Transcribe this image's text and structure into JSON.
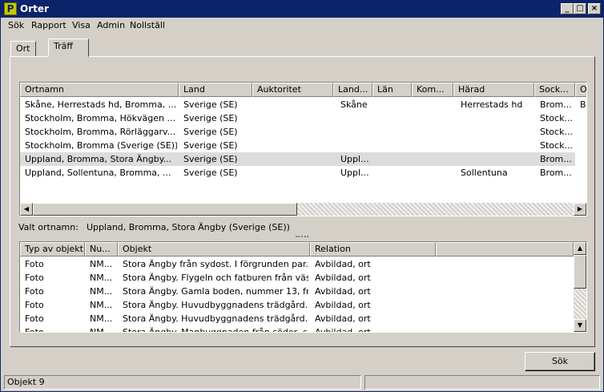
{
  "window": {
    "title": "Orter"
  },
  "menu": [
    "Sök",
    "Rapport",
    "Visa",
    "Admin",
    "Nollställ"
  ],
  "tabs": [
    "Ort",
    "Träff"
  ],
  "top_table": {
    "columns": [
      "Ortnamn",
      "Land",
      "Auktoritet",
      "Land...",
      "Län",
      "Kom...",
      "Härad",
      "Sock...",
      "O"
    ],
    "rows": [
      [
        "Skåne, Herrestads hd, Bromma, ...",
        "Sverige (SE)",
        "",
        "Skåne",
        "",
        "",
        "Herrestads hd",
        "Brom...",
        "B"
      ],
      [
        "Stockholm, Bromma, Hökvägen ...",
        "Sverige (SE)",
        "",
        "",
        "",
        "",
        "",
        "Stock...",
        ""
      ],
      [
        "Stockholm, Bromma, Rörläggarv...",
        "Sverige (SE)",
        "",
        "",
        "",
        "",
        "",
        "Stock...",
        ""
      ],
      [
        "Stockholm, Bromma (Sverige (SE))",
        "Sverige (SE)",
        "",
        "",
        "",
        "",
        "",
        "Stock...",
        ""
      ],
      [
        "Uppland, Bromma, Stora Ängby...",
        "Sverige (SE)",
        "",
        "Uppl...",
        "",
        "",
        "",
        "Brom...",
        ""
      ],
      [
        "Uppland, Sollentuna, Bromma, ...",
        "Sverige (SE)",
        "",
        "Uppl...",
        "",
        "",
        "Sollentuna",
        "Brom...",
        ""
      ]
    ],
    "selected_row": 4
  },
  "selection": {
    "label": "Valt ortnamn:",
    "value": "Uppland, Bromma, Stora Ängby (Sverige (SE))"
  },
  "bottom_table": {
    "columns": [
      "Typ av objekt",
      "Nu...",
      "Objekt",
      "Relation"
    ],
    "rows": [
      [
        "Foto",
        "NM...",
        "Stora Ängby från sydost. I förgrunden par...",
        "Avbildad, ort"
      ],
      [
        "Foto",
        "NM...",
        "Stora Ängby. Flygeln och fatburen från väs...",
        "Avbildad, ort"
      ],
      [
        "Foto",
        "NM...",
        "Stora Ängby. Gamla boden, nummer 13, fr...",
        "Avbildad, ort"
      ],
      [
        "Foto",
        "NM...",
        "Stora Ängby. Huvudbyggnadens trädgård...",
        "Avbildad, ort"
      ],
      [
        "Foto",
        "NM...",
        "Stora Ängby. Huvudbyggnadens trädgård...",
        "Avbildad, ort"
      ],
      [
        "Foto",
        "NM...",
        "Stora Ängby. Manbyggnaden från söder, s...",
        "Avbildad, ort"
      ]
    ]
  },
  "search_button": "Sök",
  "status": {
    "objects": "Objekt 9"
  }
}
